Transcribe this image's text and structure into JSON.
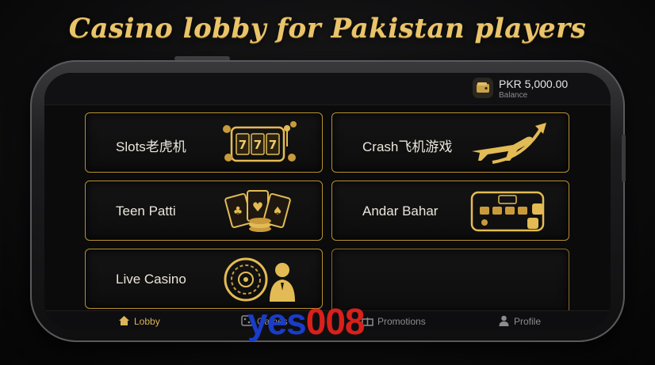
{
  "headline": "Casino lobby for Pakistan players",
  "header": {
    "balance_amount": "PKR 5,000.00",
    "balance_label": "Balance"
  },
  "games": [
    {
      "label": "Slots老虎机",
      "icon": "slot-machine-icon"
    },
    {
      "label": "Crash飞机游戏",
      "icon": "airplane-icon"
    },
    {
      "label": "Teen Patti",
      "icon": "playing-cards-icon"
    },
    {
      "label": "Andar Bahar",
      "icon": "card-table-icon"
    },
    {
      "label": "Live Casino",
      "icon": "roulette-dealer-icon"
    }
  ],
  "nav": {
    "lobby": "Lobby",
    "games": "Games",
    "promotions": "Promotions",
    "profile": "Profile"
  },
  "watermark": {
    "part1": "yes",
    "part2": "008"
  },
  "colors": {
    "accent": "#d9b45a",
    "card_border": "#b8902f",
    "background": "#0b0b0c"
  }
}
